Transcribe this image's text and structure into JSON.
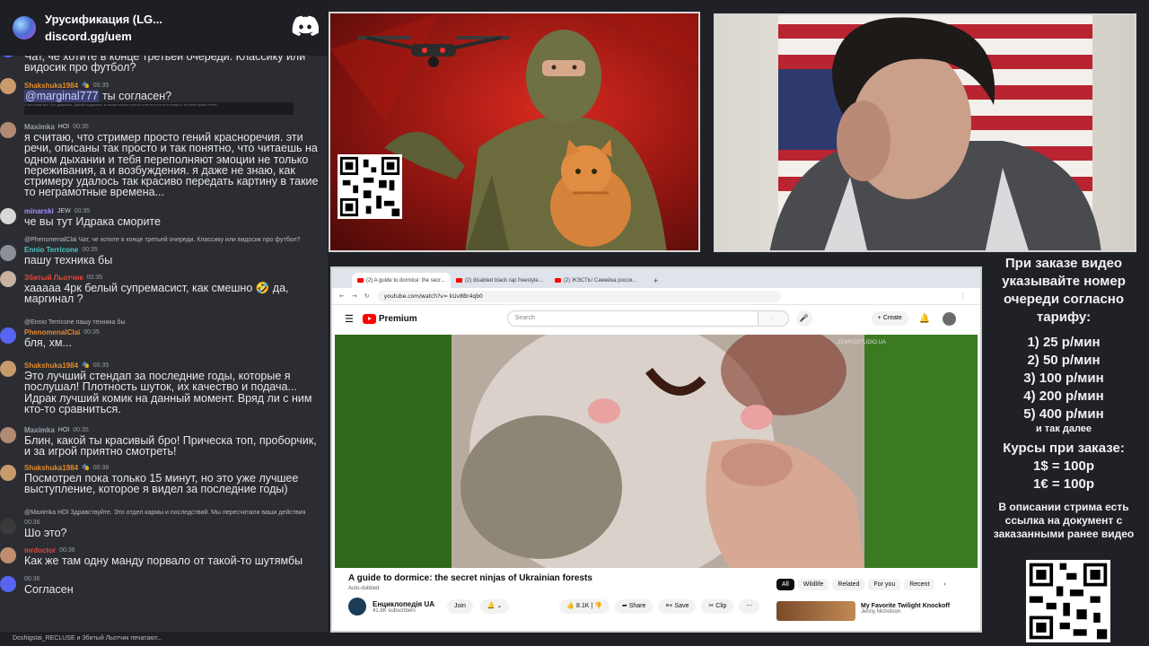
{
  "chat": {
    "server_title": "Урусификация (LG...",
    "invite": "discord.gg/uem",
    "typing": "Doshigstai_RECLUSE и Збитый Льотчик печатают...",
    "messages": [
      {
        "user": "",
        "time": "",
        "reply": "",
        "text": "Чат, че хотите в конце третьей очереди. Классику или видосик про футбол?"
      },
      {
        "user": "Shakshuka1984",
        "time": "00:35",
        "reply": "",
        "mention": "@marginal777",
        "text": " ты согласен?",
        "embed": "Сопоставь вот. Что думаешь. Давай подумаем, в каком случае лучше ответить на этот вопрос. Но мне нужно ответ."
      },
      {
        "user": "Maximka",
        "badge": "HOI",
        "time": "00:35",
        "reply": "",
        "text": "я считаю, что стример просто гений красноречия. эти речи, описаны так просто и так понятно, что читаешь на одном дыхании и тебя переполняют эмоции не только переживания, а и возбуждения. я даже не знаю, как стримеру удалось так красиво передать картину в такие то неграмотные времена..."
      },
      {
        "user": "minarski",
        "badge": "JEW",
        "time": "00:35",
        "reply": "",
        "text": "че вы тут Идрака сморите"
      },
      {
        "user": "Ennio Terricone",
        "time": "00:35",
        "reply": "@PhenomenalClai Чат, че хотите в конце третьей очереди. Классику или видосик про футбол?",
        "text": "пашу техника бы"
      },
      {
        "user": "Збитый Льотчик",
        "time": "00:35",
        "reply": "",
        "text": "хааааа 4рк белый супремасист, как смешно 🤣 да, маргинал ?"
      },
      {
        "user": "PhenomenalClai",
        "time": "00:35",
        "reply": "@Ennio Terricone пашу техника бы",
        "text": "бля, хм..."
      },
      {
        "user": "Shakshuka1984",
        "time": "00:35",
        "reply": "",
        "text": "Это лучший стендап за последние годы, которые я послушал! Плотность шуток, их качество и подача... Идрак лучший комик на данный момент. Вряд ли с ним кто-то сравниться."
      },
      {
        "user": "Maximka",
        "badge": "HOI",
        "time": "00:35",
        "reply": "",
        "text": "Блин, какой ты красивый бро! Прическа топ, проборчик, и за игрой приятно смотреть!"
      },
      {
        "user": "Shakshuka1984",
        "time": "00:36",
        "reply": "",
        "text": "Посмотрел пока только 15 минут, но это уже лучшее выступление, которое я видел за последние годы)"
      },
      {
        "user": "",
        "time": "00:36",
        "reply": "@Maximka HOI Здравствуйте. Это отдел кармы и последствий. Мы пересчитали ваши действия",
        "text": "Шо это?"
      },
      {
        "user": "mrdoctor",
        "time": "00:36",
        "reply": "",
        "text": "Как же там одну манду порвало от такой-то шутямбы"
      },
      {
        "user": "",
        "time": "00:36",
        "reply": "",
        "text": "Согласен"
      }
    ]
  },
  "browser": {
    "tabs": [
      "(2) A guide to dormice: the secr...",
      "(2) disabled black rap freestyle...",
      "(2) ЖЭСТЬ! Самейка росси..."
    ],
    "url": "youtube.com/watch?v= kUv8Br4qb0",
    "yt_brand": "Premium",
    "search_placeholder": "Search",
    "create_label": "Create",
    "notif_count": "2",
    "watermark": "ZEMPOSTUDIO.UA",
    "video_title": "A guide to dormice: the secret ninjas of Ukrainian forests",
    "auto_dubbed": "Auto-dubbed",
    "channel_name": "Енциклопедія UA",
    "channel_subs": "41.8K subscribers",
    "join_label": "Join",
    "likes": "8.1K",
    "share_label": "Share",
    "save_label": "Save",
    "clip_label": "Clip",
    "chips": [
      "All",
      "Wildlife",
      "Related",
      "For you",
      "Recent"
    ],
    "rec_title": "My Favorite Twilight Knockoff",
    "rec_channel": "Jenny Nicholson"
  },
  "info": {
    "line1": "При заказе видео указывайте номер очереди согласно тарифу:",
    "tariffs": [
      "1) 25 р/мин",
      "2) 50 р/мин",
      "3) 100 р/мин",
      "4) 200 р/мин",
      "5) 400 р/мин"
    ],
    "etc": "и так далее",
    "rates_title": "Курсы при заказе:",
    "rates": [
      "1$ = 100р",
      "1€ = 100р"
    ],
    "footer": "В описании стрима есть ссылка на документ с заказанными ранее видео"
  },
  "colors": {
    "chat_bg": "#2b2d33",
    "page_bg": "#1f2127",
    "name_orange": "#e58a2c",
    "name_teal": "#52c3c0",
    "name_red": "#e2493b",
    "name_purple": "#a78bfa",
    "poster_red": "#c4221a",
    "yt_red": "#ff0000"
  }
}
